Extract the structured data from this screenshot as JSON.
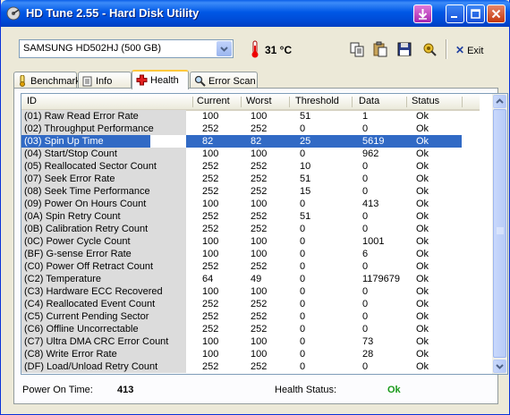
{
  "window": {
    "title": "HD Tune 2.55 - Hard Disk Utility"
  },
  "toolbar": {
    "drive": "SAMSUNG HD502HJ (500 GB)",
    "temperature": "31 °C",
    "exit_label": "Exit"
  },
  "tabs": [
    {
      "label": "Benchmark"
    },
    {
      "label": "Info"
    },
    {
      "label": "Health"
    },
    {
      "label": "Error Scan"
    }
  ],
  "table": {
    "columns": [
      "ID",
      "Current",
      "Worst",
      "Threshold",
      "Data",
      "Status"
    ],
    "rows": [
      [
        "(01) Raw Read Error Rate",
        "100",
        "100",
        "51",
        "1",
        "Ok"
      ],
      [
        "(02) Throughput Performance",
        "252",
        "252",
        "0",
        "0",
        "Ok"
      ],
      [
        "(03) Spin Up Time",
        "82",
        "82",
        "25",
        "5619",
        "Ok"
      ],
      [
        "(04) Start/Stop Count",
        "100",
        "100",
        "0",
        "962",
        "Ok"
      ],
      [
        "(05) Reallocated Sector Count",
        "252",
        "252",
        "10",
        "0",
        "Ok"
      ],
      [
        "(07) Seek Error Rate",
        "252",
        "252",
        "51",
        "0",
        "Ok"
      ],
      [
        "(08) Seek Time Performance",
        "252",
        "252",
        "15",
        "0",
        "Ok"
      ],
      [
        "(09) Power On Hours Count",
        "100",
        "100",
        "0",
        "413",
        "Ok"
      ],
      [
        "(0A) Spin Retry Count",
        "252",
        "252",
        "51",
        "0",
        "Ok"
      ],
      [
        "(0B) Calibration Retry Count",
        "252",
        "252",
        "0",
        "0",
        "Ok"
      ],
      [
        "(0C) Power Cycle Count",
        "100",
        "100",
        "0",
        "1001",
        "Ok"
      ],
      [
        "(BF) G-sense Error Rate",
        "100",
        "100",
        "0",
        "6",
        "Ok"
      ],
      [
        "(C0) Power Off Retract Count",
        "252",
        "252",
        "0",
        "0",
        "Ok"
      ],
      [
        "(C2) Temperature",
        "64",
        "49",
        "0",
        "1179679",
        "Ok"
      ],
      [
        "(C3) Hardware ECC Recovered",
        "100",
        "100",
        "0",
        "0",
        "Ok"
      ],
      [
        "(C4) Reallocated Event Count",
        "252",
        "252",
        "0",
        "0",
        "Ok"
      ],
      [
        "(C5) Current Pending Sector",
        "252",
        "252",
        "0",
        "0",
        "Ok"
      ],
      [
        "(C6) Offline Uncorrectable",
        "252",
        "252",
        "0",
        "0",
        "Ok"
      ],
      [
        "(C7) Ultra DMA CRC Error Count",
        "100",
        "100",
        "0",
        "73",
        "Ok"
      ],
      [
        "(C8) Write Error Rate",
        "100",
        "100",
        "0",
        "28",
        "Ok"
      ],
      [
        "(DF) Load/Unload Retry Count",
        "252",
        "252",
        "0",
        "0",
        "Ok"
      ]
    ],
    "selected_row": 2
  },
  "footer": {
    "power_on_label": "Power On Time:",
    "power_on_value": "413",
    "health_label": "Health Status:",
    "health_value": "Ok"
  },
  "colors": {
    "selection": "#316ac5",
    "ok_green": "#1a9a1a",
    "title_blue": "#0058e6"
  }
}
